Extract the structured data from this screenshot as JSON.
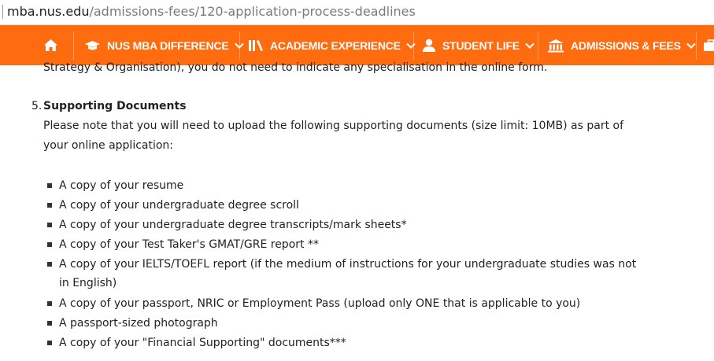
{
  "browser": {
    "url_host": "mba.nus.edu",
    "url_path": "/admissions-fees/120-application-process-deadlines"
  },
  "nav": {
    "brand_color": "#ff6b0f",
    "items": [
      {
        "label": "",
        "icon": "home-icon"
      },
      {
        "label": "NUS MBA DIFFERENCE",
        "icon": "graduation-cap-icon"
      },
      {
        "label": "ACADEMIC EXPERIENCE",
        "icon": "library-icon"
      },
      {
        "label": "STUDENT LIFE",
        "icon": "user-icon"
      },
      {
        "label": "ADMISSIONS & FEES",
        "icon": "institution-icon"
      },
      {
        "label": "",
        "icon": "briefcase-icon"
      }
    ]
  },
  "content": {
    "prev_text_tail": "Strategy & Organisation), you do not need to indicate any specialisation in the online form.",
    "section_number": "5.",
    "section_title": "Supporting Documents",
    "intro_line1": "Please note that you will need to upload the following supporting documents (size limit: 10MB) as part of",
    "intro_line2": "your online application:",
    "documents": [
      " A copy of your resume",
      "A copy of your undergraduate degree scroll",
      "A copy of your undergraduate degree transcripts/mark sheets*",
      "A copy of your Test Taker's GMAT/GRE report **",
      "A copy of your IELTS/TOEFL report (if the medium of instructions for your undergraduate studies was not",
      "in English)",
      "A copy of your passport, NRIC or Employment Pass (upload only ONE that is applicable to you)",
      "A passport-sized photograph",
      "A copy of your \"Financial Supporting\" documents***"
    ]
  }
}
